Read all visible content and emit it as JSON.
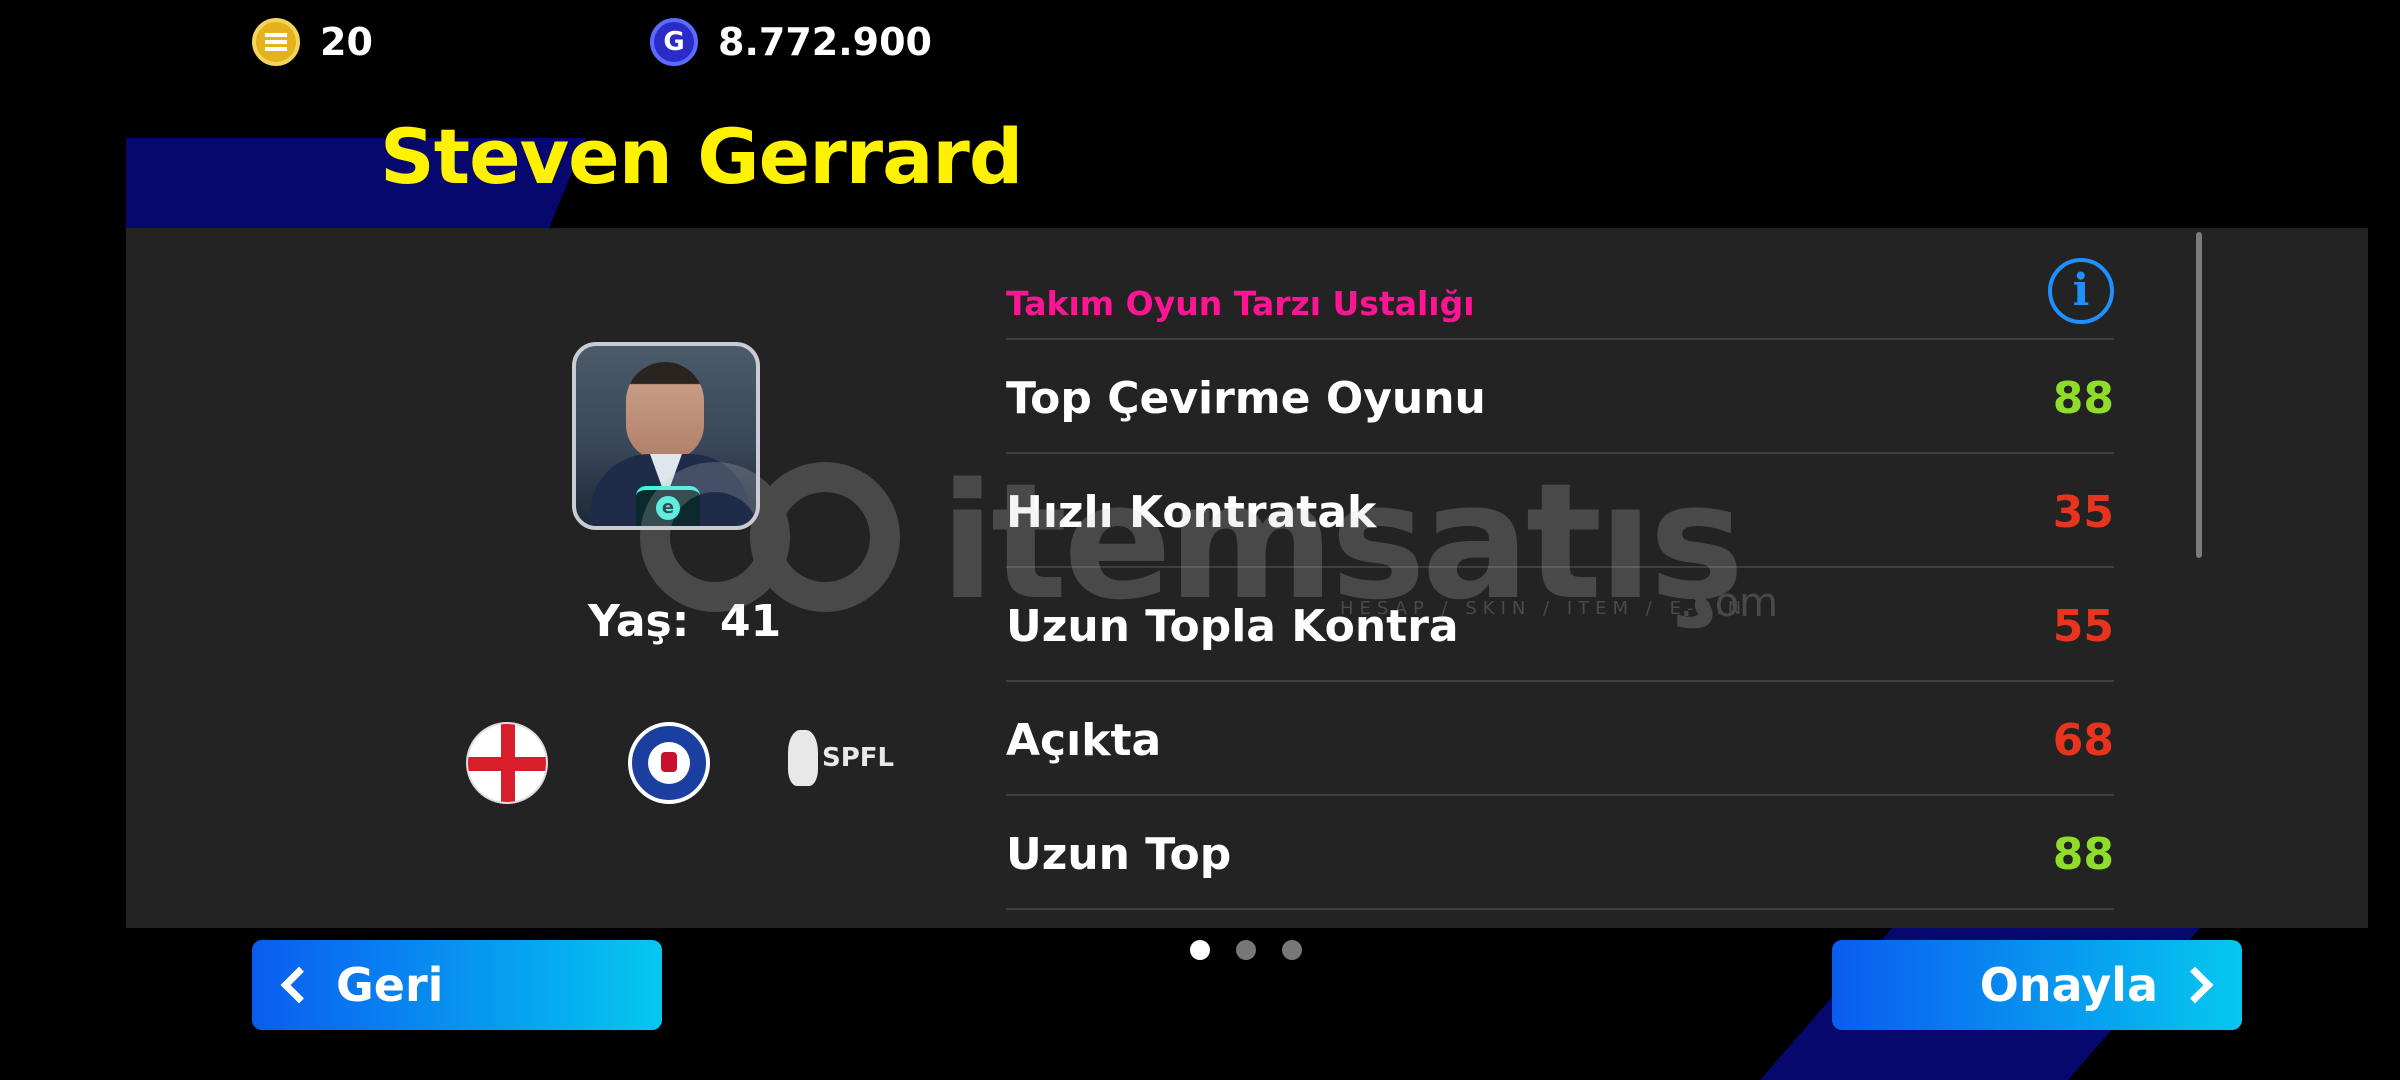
{
  "currency": {
    "coins": {
      "icon": "efootball-coin-icon",
      "value": "20"
    },
    "gp": {
      "icon": "gp-icon",
      "value": "8.772.900"
    }
  },
  "player": {
    "name": "Steven Gerrard",
    "age_label": "Yaş:",
    "age_value": "41",
    "nationality_icon": "england-flag-icon",
    "club_icon": "rangers-fc-crest-icon",
    "league_icon": "spfl-logo-icon",
    "league_text": "SPFL"
  },
  "section": {
    "title": "Takım Oyun Tarzı Ustalığı",
    "info_icon": "info-icon",
    "rows": [
      {
        "label": "Top Çevirme Oyunu",
        "value": "88",
        "color": "#8fdd2a"
      },
      {
        "label": "Hızlı Kontratak",
        "value": "35",
        "color": "#e8341c"
      },
      {
        "label": "Uzun Topla Kontra",
        "value": "55",
        "color": "#e8341c"
      },
      {
        "label": "Açıkta",
        "value": "68",
        "color": "#e8341c"
      },
      {
        "label": "Uzun Top",
        "value": "88",
        "color": "#8fdd2a"
      }
    ]
  },
  "watermark": {
    "brand": "itemsatış",
    "tagline": "HESAP / SKIN / ITEM / E-PIN",
    "suffix": ".com"
  },
  "pagination": {
    "pages": 3,
    "active": 0
  },
  "buttons": {
    "back_label": "Geri",
    "confirm_label": "Onayla"
  },
  "colors": {
    "accent_title": "#fff200",
    "section_title": "#ff1493",
    "button": "#0a8cf0"
  }
}
